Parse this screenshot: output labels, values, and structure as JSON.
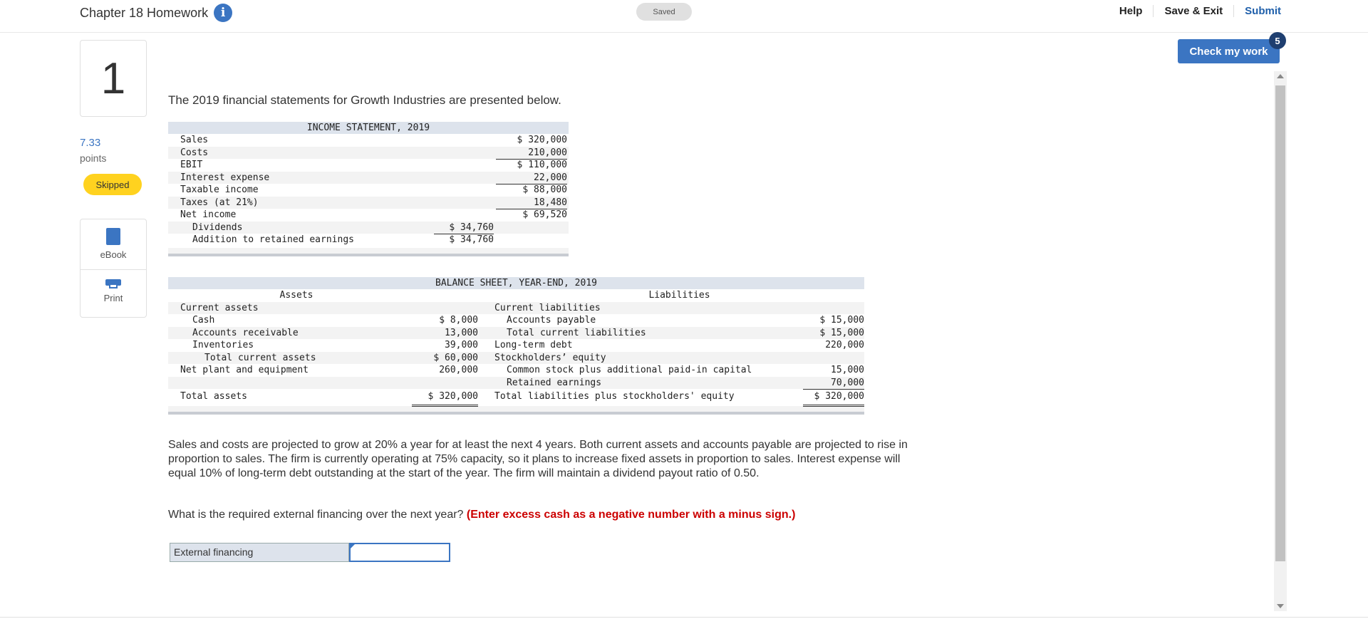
{
  "header": {
    "title": "Chapter 18 Homework",
    "saved": "Saved",
    "links": [
      "Help",
      "Save & Exit",
      "Submit"
    ],
    "check_label": "Check my work",
    "check_badge": "5"
  },
  "question": {
    "number": "1",
    "points": "7.33",
    "points_label": "points",
    "status": "Skipped",
    "tools": [
      "eBook",
      "Print"
    ],
    "prompt": "The 2019 financial statements for Growth Industries are presented below."
  },
  "income_statement": {
    "title": "INCOME STATEMENT, 2019",
    "rows": [
      {
        "label": "Sales",
        "c1": "",
        "c2": "$ 320,000"
      },
      {
        "label": "Costs",
        "c1": "",
        "c2": "210,000"
      },
      {
        "label": "EBIT",
        "c1": "",
        "c2": "$ 110,000"
      },
      {
        "label": "Interest expense",
        "c1": "",
        "c2": "22,000"
      },
      {
        "label": "Taxable income",
        "c1": "",
        "c2": "$  88,000"
      },
      {
        "label": "Taxes (at 21%)",
        "c1": "",
        "c2": "18,480"
      },
      {
        "label": "Net income",
        "c1": "",
        "c2": "$  69,520"
      },
      {
        "label": "Dividends",
        "c1": "$ 34,760",
        "c2": ""
      },
      {
        "label": "Addition to retained earnings",
        "c1": "$ 34,760",
        "c2": ""
      }
    ]
  },
  "balance_sheet": {
    "title": "BALANCE SHEET, YEAR-END, 2019",
    "assets_header": "Assets",
    "liabilities_header": "Liabilities",
    "rows": [
      {
        "a_label": "Current assets",
        "a_val": "",
        "l_label": "Current liabilities",
        "l_val": ""
      },
      {
        "a_label": "Cash",
        "a_val": "$    8,000",
        "l_label": "Accounts payable",
        "l_val": "$  15,000"
      },
      {
        "a_label": "Accounts receivable",
        "a_val": "13,000",
        "l_label": "Total current liabilities",
        "l_val": "$  15,000"
      },
      {
        "a_label": "Inventories",
        "a_val": "39,000",
        "l_label": "Long-term debt",
        "l_val": "220,000"
      },
      {
        "a_label": "Total current assets",
        "a_val": "$  60,000",
        "l_label": "Stockholders’ equity",
        "l_val": ""
      },
      {
        "a_label": "Net plant and equipment",
        "a_val": "260,000",
        "l_label": "Common stock plus additional paid-in capital",
        "l_val": "15,000"
      },
      {
        "a_label": "",
        "a_val": "",
        "l_label": "Retained earnings",
        "l_val": "70,000"
      },
      {
        "a_label": "Total assets",
        "a_val": "$ 320,000",
        "l_label": "Total liabilities plus stockholders' equity",
        "l_val": "$ 320,000"
      }
    ]
  },
  "description": "Sales and costs are projected to grow at 20% a year for at least the next 4 years. Both current assets and accounts payable are projected to rise in proportion to sales. The firm is currently operating at 75% capacity, so it plans to increase fixed assets in proportion to sales. Interest expense will equal 10% of long-term debt outstanding at the start of the year. The firm will maintain a dividend payout ratio of 0.50.",
  "ask": {
    "text": "What is the required external financing over the next year?",
    "hint": "(Enter excess cash as a negative number with a minus sign.)"
  },
  "answer": {
    "label": "External financing",
    "value": ""
  }
}
